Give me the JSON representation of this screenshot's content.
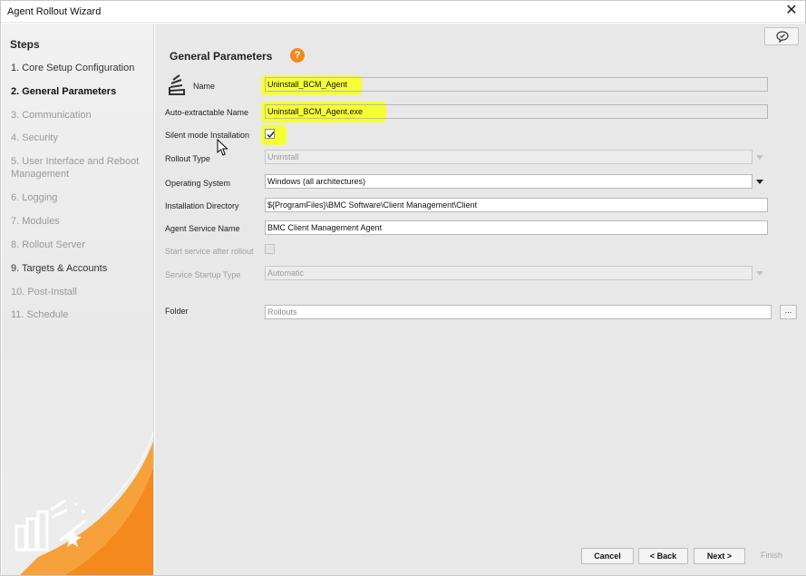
{
  "window": {
    "title": "Agent Rollout Wizard",
    "close_glyph": "✕"
  },
  "sidebar": {
    "title": "Steps",
    "steps": [
      {
        "label": "1. Core Setup Configuration",
        "state": "done"
      },
      {
        "label": "2. General Parameters",
        "state": "active"
      },
      {
        "label": "3. Communication",
        "state": "pending"
      },
      {
        "label": "4. Security",
        "state": "pending"
      },
      {
        "label": "5. User Interface and Reboot Management",
        "state": "pending"
      },
      {
        "label": "6. Logging",
        "state": "pending"
      },
      {
        "label": "7. Modules",
        "state": "pending"
      },
      {
        "label": "8. Rollout Server",
        "state": "pending"
      },
      {
        "label": "9. Targets & Accounts",
        "state": "done"
      },
      {
        "label": "10. Post-Install",
        "state": "pending"
      },
      {
        "label": "11. Schedule",
        "state": "pending"
      }
    ]
  },
  "main": {
    "title": "General Parameters",
    "help_glyph": "?",
    "fields": {
      "name": {
        "label": "Name",
        "value": "Uninstall_BCM_Agent"
      },
      "auto_extractable_name": {
        "label": "Auto-extractable Name",
        "value": "Uninstall_BCM_Agent.exe"
      },
      "silent_mode": {
        "label": "Silent mode Installation",
        "checked": true
      },
      "rollout_type": {
        "label": "Rollout Type",
        "value": "Uninstall",
        "enabled": false
      },
      "operating_system": {
        "label": "Operating System",
        "value": "Windows (all architectures)"
      },
      "installation_directory": {
        "label": "Installation Directory",
        "value": "${ProgramFiles}\\BMC Software\\Client Management\\Client"
      },
      "agent_service_name": {
        "label": "Agent Service Name",
        "value": "BMC Client Management Agent"
      },
      "start_service_after_rollout": {
        "label": "Start service after rollout",
        "checked": false,
        "enabled": false
      },
      "service_startup_type": {
        "label": "Service Startup Type",
        "value": "Automatic",
        "enabled": false
      },
      "folder": {
        "label": "Folder",
        "value": "Rollouts",
        "browse_label": "..."
      }
    }
  },
  "buttons": {
    "cancel": "Cancel",
    "back": "< Back",
    "next": "Next >",
    "finish": "Finish"
  },
  "colors": {
    "accent_orange": "#f28a1e",
    "highlight_yellow": "#f6ff33"
  }
}
